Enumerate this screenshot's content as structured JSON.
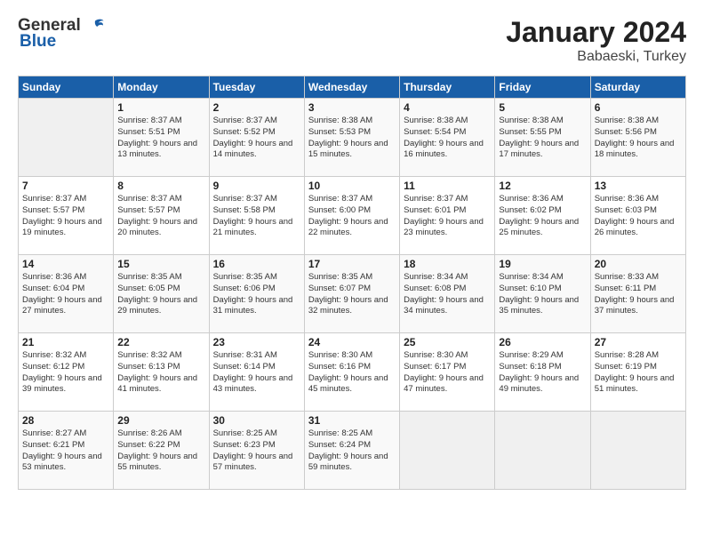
{
  "header": {
    "logo_general": "General",
    "logo_blue": "Blue",
    "title": "January 2024",
    "subtitle": "Babaeski, Turkey"
  },
  "days_of_week": [
    "Sunday",
    "Monday",
    "Tuesday",
    "Wednesday",
    "Thursday",
    "Friday",
    "Saturday"
  ],
  "weeks": [
    [
      {
        "day": "",
        "info": ""
      },
      {
        "day": "1",
        "info": "Sunrise: 8:37 AM\nSunset: 5:51 PM\nDaylight: 9 hours\nand 13 minutes."
      },
      {
        "day": "2",
        "info": "Sunrise: 8:37 AM\nSunset: 5:52 PM\nDaylight: 9 hours\nand 14 minutes."
      },
      {
        "day": "3",
        "info": "Sunrise: 8:38 AM\nSunset: 5:53 PM\nDaylight: 9 hours\nand 15 minutes."
      },
      {
        "day": "4",
        "info": "Sunrise: 8:38 AM\nSunset: 5:54 PM\nDaylight: 9 hours\nand 16 minutes."
      },
      {
        "day": "5",
        "info": "Sunrise: 8:38 AM\nSunset: 5:55 PM\nDaylight: 9 hours\nand 17 minutes."
      },
      {
        "day": "6",
        "info": "Sunrise: 8:38 AM\nSunset: 5:56 PM\nDaylight: 9 hours\nand 18 minutes."
      }
    ],
    [
      {
        "day": "7",
        "info": "Sunrise: 8:37 AM\nSunset: 5:57 PM\nDaylight: 9 hours\nand 19 minutes."
      },
      {
        "day": "8",
        "info": "Sunrise: 8:37 AM\nSunset: 5:57 PM\nDaylight: 9 hours\nand 20 minutes."
      },
      {
        "day": "9",
        "info": "Sunrise: 8:37 AM\nSunset: 5:58 PM\nDaylight: 9 hours\nand 21 minutes."
      },
      {
        "day": "10",
        "info": "Sunrise: 8:37 AM\nSunset: 6:00 PM\nDaylight: 9 hours\nand 22 minutes."
      },
      {
        "day": "11",
        "info": "Sunrise: 8:37 AM\nSunset: 6:01 PM\nDaylight: 9 hours\nand 23 minutes."
      },
      {
        "day": "12",
        "info": "Sunrise: 8:36 AM\nSunset: 6:02 PM\nDaylight: 9 hours\nand 25 minutes."
      },
      {
        "day": "13",
        "info": "Sunrise: 8:36 AM\nSunset: 6:03 PM\nDaylight: 9 hours\nand 26 minutes."
      }
    ],
    [
      {
        "day": "14",
        "info": "Sunrise: 8:36 AM\nSunset: 6:04 PM\nDaylight: 9 hours\nand 27 minutes."
      },
      {
        "day": "15",
        "info": "Sunrise: 8:35 AM\nSunset: 6:05 PM\nDaylight: 9 hours\nand 29 minutes."
      },
      {
        "day": "16",
        "info": "Sunrise: 8:35 AM\nSunset: 6:06 PM\nDaylight: 9 hours\nand 31 minutes."
      },
      {
        "day": "17",
        "info": "Sunrise: 8:35 AM\nSunset: 6:07 PM\nDaylight: 9 hours\nand 32 minutes."
      },
      {
        "day": "18",
        "info": "Sunrise: 8:34 AM\nSunset: 6:08 PM\nDaylight: 9 hours\nand 34 minutes."
      },
      {
        "day": "19",
        "info": "Sunrise: 8:34 AM\nSunset: 6:10 PM\nDaylight: 9 hours\nand 35 minutes."
      },
      {
        "day": "20",
        "info": "Sunrise: 8:33 AM\nSunset: 6:11 PM\nDaylight: 9 hours\nand 37 minutes."
      }
    ],
    [
      {
        "day": "21",
        "info": "Sunrise: 8:32 AM\nSunset: 6:12 PM\nDaylight: 9 hours\nand 39 minutes."
      },
      {
        "day": "22",
        "info": "Sunrise: 8:32 AM\nSunset: 6:13 PM\nDaylight: 9 hours\nand 41 minutes."
      },
      {
        "day": "23",
        "info": "Sunrise: 8:31 AM\nSunset: 6:14 PM\nDaylight: 9 hours\nand 43 minutes."
      },
      {
        "day": "24",
        "info": "Sunrise: 8:30 AM\nSunset: 6:16 PM\nDaylight: 9 hours\nand 45 minutes."
      },
      {
        "day": "25",
        "info": "Sunrise: 8:30 AM\nSunset: 6:17 PM\nDaylight: 9 hours\nand 47 minutes."
      },
      {
        "day": "26",
        "info": "Sunrise: 8:29 AM\nSunset: 6:18 PM\nDaylight: 9 hours\nand 49 minutes."
      },
      {
        "day": "27",
        "info": "Sunrise: 8:28 AM\nSunset: 6:19 PM\nDaylight: 9 hours\nand 51 minutes."
      }
    ],
    [
      {
        "day": "28",
        "info": "Sunrise: 8:27 AM\nSunset: 6:21 PM\nDaylight: 9 hours\nand 53 minutes."
      },
      {
        "day": "29",
        "info": "Sunrise: 8:26 AM\nSunset: 6:22 PM\nDaylight: 9 hours\nand 55 minutes."
      },
      {
        "day": "30",
        "info": "Sunrise: 8:25 AM\nSunset: 6:23 PM\nDaylight: 9 hours\nand 57 minutes."
      },
      {
        "day": "31",
        "info": "Sunrise: 8:25 AM\nSunset: 6:24 PM\nDaylight: 9 hours\nand 59 minutes."
      },
      {
        "day": "",
        "info": ""
      },
      {
        "day": "",
        "info": ""
      },
      {
        "day": "",
        "info": ""
      }
    ]
  ]
}
